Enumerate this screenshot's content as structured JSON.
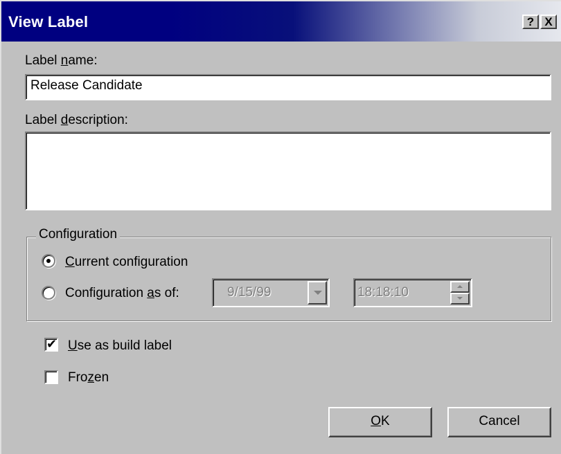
{
  "window": {
    "title": "View Label",
    "help_glyph": "?",
    "close_glyph": "X"
  },
  "label_name": {
    "pre": "Label ",
    "accel": "n",
    "post": "ame:",
    "value": "Release Candidate"
  },
  "label_description": {
    "pre": "Label ",
    "accel": "d",
    "post": "escription:",
    "value": ""
  },
  "configuration": {
    "legend": "Configuration",
    "current": {
      "accel": "C",
      "post": "urrent configuration",
      "selected": true
    },
    "as_of": {
      "pre": "Configuration ",
      "accel": "a",
      "post": "s of:",
      "selected": false,
      "date": "9/15/99",
      "time": "18:18:10"
    }
  },
  "options": {
    "use_as_build": {
      "accel": "U",
      "post": "se as build label",
      "checked": true
    },
    "frozen": {
      "pre": "Fro",
      "accel": "z",
      "post": "en",
      "checked": false
    }
  },
  "buttons": {
    "ok": {
      "accel": "O",
      "post": "K"
    },
    "cancel": "Cancel"
  },
  "icons": {
    "help": "help-icon",
    "close": "close-icon",
    "dropdown": "chevron-down-icon",
    "check": "checkmark-icon"
  }
}
